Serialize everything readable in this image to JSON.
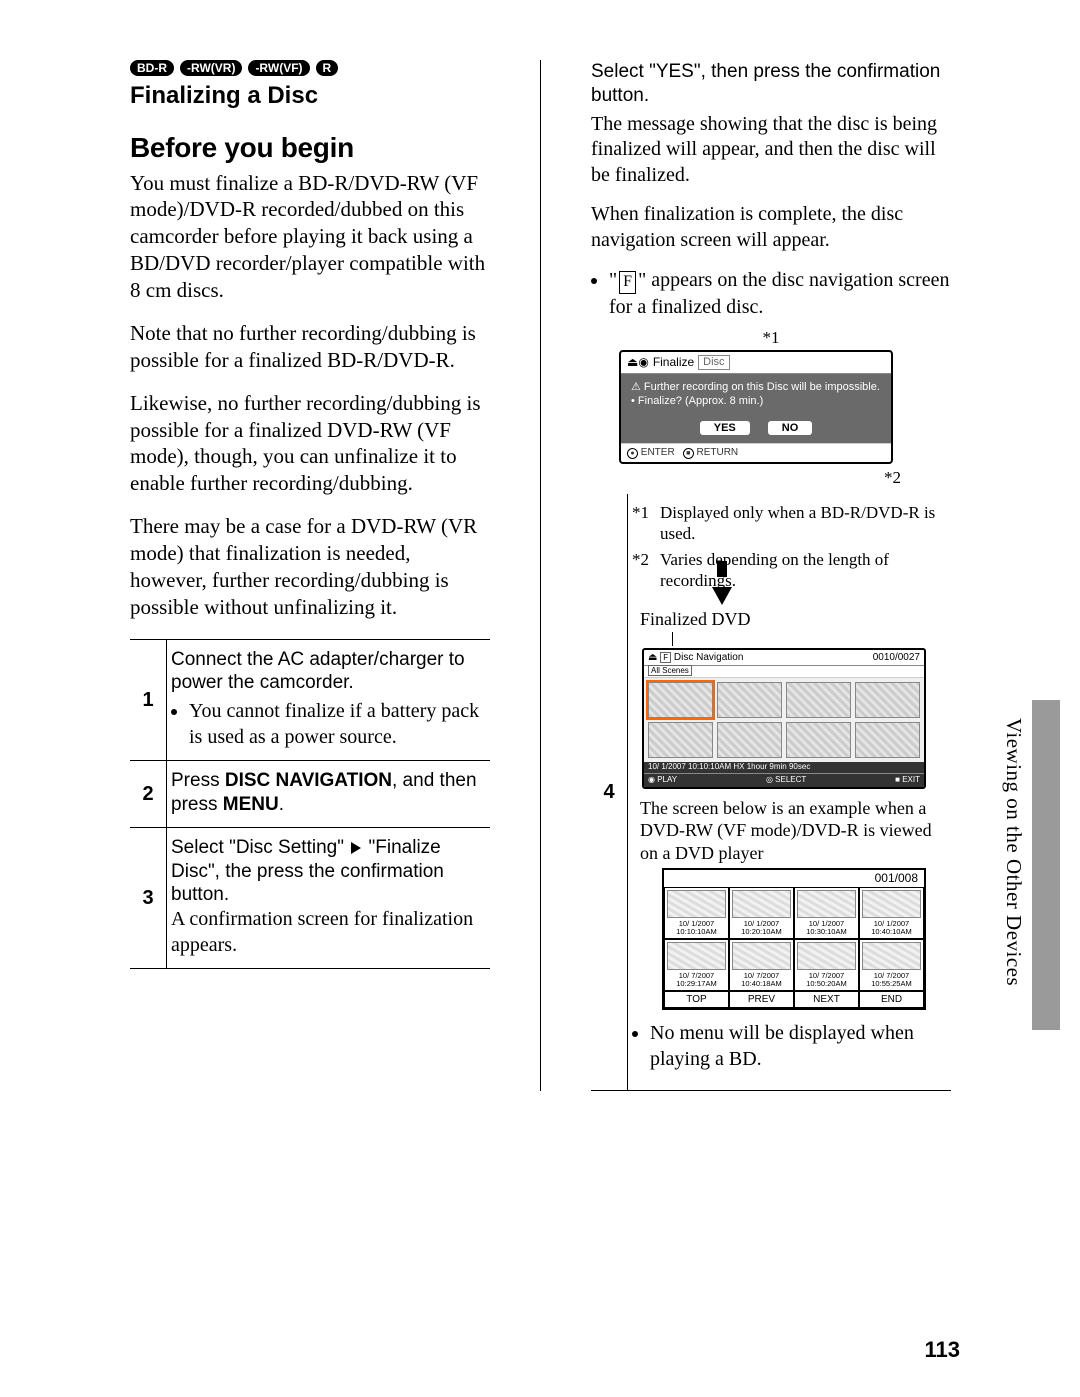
{
  "badges": [
    "BD-R",
    "-RW(VR)",
    "-RW(VF)",
    "R"
  ],
  "heading_finalizing": "Finalizing a Disc",
  "heading_before": "Before you begin",
  "intro_paras": [
    "You must finalize a BD-R/DVD-RW (VF mode)/DVD-R recorded/dubbed on this camcorder before playing it back using a BD/DVD recorder/player compatible with 8 cm discs.",
    "Note that no further recording/dubbing is possible for a finalized BD-R/DVD-R.",
    "Likewise, no further recording/dubbing is possible for a finalized DVD-RW (VF mode), though, you can unfinalize it to enable further recording/dubbing.",
    "There may be a case for a DVD-RW (VR mode) that finalization is needed, however, further recording/dubbing is possible without unfinalizing it."
  ],
  "steps": {
    "s1": {
      "num": "1",
      "cond": "Connect the AC adapter/charger to power the camcorder.",
      "bullet": "You cannot finalize if a battery pack is used as a power source."
    },
    "s2": {
      "num": "2",
      "cond_pre": "Press ",
      "cond_b1": "DISC NAVIGATION",
      "cond_mid": ", and then press ",
      "cond_b2": "MENU",
      "cond_post": "."
    },
    "s3": {
      "num": "3",
      "cond_a": "Select \"Disc Setting\"",
      "cond_b": "\"Finalize Disc\", the press the confirmation button.",
      "body": "A confirmation screen for finalization appears."
    },
    "s4": {
      "num": "4",
      "cond": "Select \"YES\", then press the confirmation button.",
      "body1": "The message showing that the disc is being finalized will appear, and then the disc will be finalized.",
      "body2": "When finalization is complete, the disc navigation screen will appear.",
      "f_letter": "F",
      "bullet_f": "\" appears on the disc navigation screen for a finalized disc.",
      "star1": "*1",
      "star2": "*2",
      "fn1": "Displayed only when a BD-R/DVD-R is used.",
      "fn2": "Varies depending on the length of recordings.",
      "finalized_caption": "Finalized DVD",
      "subcap": "The screen below is an example when a DVD-RW (VF mode)/DVD-R is viewed on a DVD player",
      "nomenu": "No menu will be displayed when playing a BD."
    }
  },
  "finalize_screen": {
    "icons": "⏏◉",
    "tab1": "Finalize",
    "tab2": "Disc",
    "warn_line": "⚠ Further recording on this Disc will be impossible.",
    "time_line": "• Finalize? (Approx. 8 min.)",
    "yes": "YES",
    "no": "NO",
    "enter": "ENTER",
    "return": "RETURN"
  },
  "nav_screen": {
    "title": "Disc Navigation",
    "tag": "F",
    "scenes": "All Scenes",
    "count": "0010/0027",
    "status": "10/ 1/2007  10:10:10AM   HX   1hour 9min 90sec",
    "foot_play": "PLAY",
    "foot_select": "SELECT",
    "foot_exit": "EXIT"
  },
  "dvd_table": {
    "count": "001/008",
    "cells": [
      {
        "d": "10/ 1/2007",
        "t": "10:10:10AM"
      },
      {
        "d": "10/ 1/2007",
        "t": "10:20:10AM"
      },
      {
        "d": "10/ 1/2007",
        "t": "10:30:10AM"
      },
      {
        "d": "10/ 1/2007",
        "t": "10:40:10AM"
      },
      {
        "d": "10/ 7/2007",
        "t": "10:29:17AM"
      },
      {
        "d": "10/ 7/2007",
        "t": "10:40:18AM"
      },
      {
        "d": "10/ 7/2007",
        "t": "10:50:20AM"
      },
      {
        "d": "10/ 7/2007",
        "t": "10:55:25AM"
      }
    ],
    "buttons": [
      "TOP",
      "PREV",
      "NEXT",
      "END"
    ]
  },
  "side_label": "Viewing on the Other Devices",
  "page_number": "113"
}
